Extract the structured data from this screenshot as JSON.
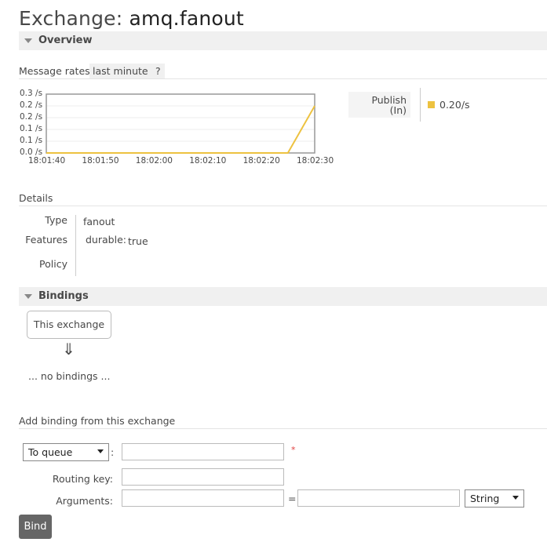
{
  "page": {
    "title_prefix": "Exchange: ",
    "title_name": "amq.fanout"
  },
  "overview": {
    "section_label": "Overview",
    "message_rates_label": "Message rates",
    "range_label": "last minute",
    "help_label": "?"
  },
  "chart_data": {
    "type": "line",
    "x": [
      "18:01:40",
      "18:01:50",
      "18:02:00",
      "18:02:10",
      "18:02:20",
      "18:02:25",
      "18:02:30"
    ],
    "y_ticks": [
      "0.3 /s",
      "0.2 /s",
      "0.2 /s",
      "0.1 /s",
      "0.1 /s",
      "0.0 /s"
    ],
    "x_ticks": [
      "18:01:40",
      "18:01:50",
      "18:02:00",
      "18:02:10",
      "18:02:20",
      "18:02:30"
    ],
    "ylim": [
      0,
      0.25
    ],
    "series": [
      {
        "name": "Publish (In)",
        "color": "#edc240",
        "points": [
          {
            "x": "18:01:40",
            "y": 0
          },
          {
            "x": "18:02:25",
            "y": 0
          },
          {
            "x": "18:02:30",
            "y": 0.2
          }
        ]
      }
    ],
    "legend": {
      "label_line1": "Publish",
      "label_line2": "(In)",
      "value": "0.20/s"
    }
  },
  "details": {
    "section_label": "Details",
    "type_label": "Type",
    "type_value": "fanout",
    "features_label": "Features",
    "durable_key": "durable:",
    "durable_value": "true",
    "policy_label": "Policy"
  },
  "bindings": {
    "section_label": "Bindings",
    "source_node": "This exchange",
    "arrow": "⇓",
    "empty_text": "... no bindings ..."
  },
  "add_binding": {
    "heading": "Add binding from this exchange",
    "destination_type": "To queue",
    "colon": ":",
    "required_marker": "*",
    "routing_key_label": "Routing key:",
    "arguments_label": "Arguments:",
    "equals": "=",
    "arg_type": "String",
    "bind_button": "Bind"
  }
}
